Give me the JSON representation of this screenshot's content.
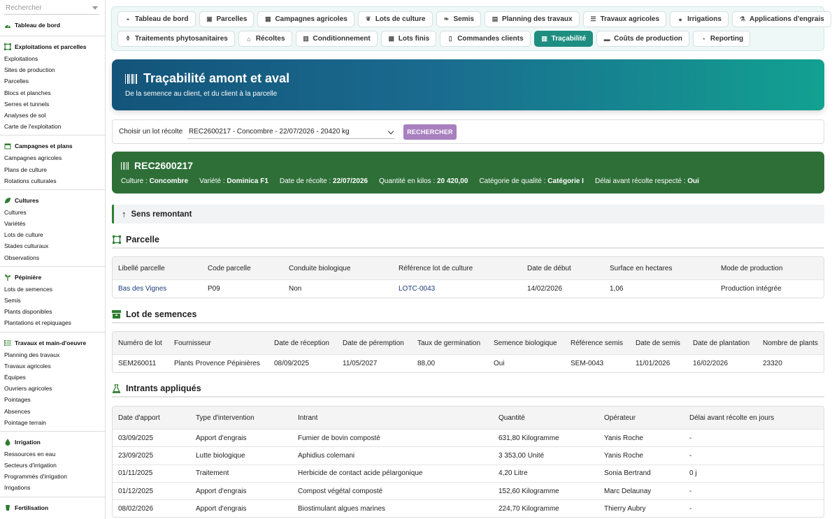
{
  "sidebar": {
    "search_placeholder": "Rechercher",
    "dashboard": "Tableau de bord",
    "sections": [
      {
        "title": "Exploitations et parcelles",
        "items": [
          "Exploitations",
          "Sites de production",
          "Parcelles",
          "Blocs et planches",
          "Serres et tunnels",
          "Analyses de sol",
          "Carte de l'exploitation"
        ]
      },
      {
        "title": "Campagnes et plans",
        "items": [
          "Campagnes agricoles",
          "Plans de culture",
          "Rotations culturales"
        ]
      },
      {
        "title": "Cultures",
        "items": [
          "Cultures",
          "Variétés",
          "Lots de culture",
          "Stades culturaux",
          "Observations"
        ]
      },
      {
        "title": "Pépinière",
        "items": [
          "Lots de semences",
          "Semis",
          "Plants disponibles",
          "Plantations et repiquages"
        ]
      },
      {
        "title": "Travaux et main-d'oeuvre",
        "items": [
          "Planning des travaux",
          "Travaux agricoles",
          "Équipes",
          "Ouvriers agricoles",
          "Pointages",
          "Absences",
          "Pointage terrain"
        ]
      },
      {
        "title": "Irrigation",
        "items": [
          "Ressources en eau",
          "Secteurs d'irrigation",
          "Programmés d'irrigation",
          "Irrigations"
        ]
      },
      {
        "title": "Fertilisation",
        "items": []
      }
    ]
  },
  "topnav": {
    "row1": [
      "Tableau de bord",
      "Parcelles",
      "Campagnes agricoles",
      "Lots de culture",
      "Semis",
      "Planning des travaux",
      "Travaux agricoles",
      "Irrigations",
      "Applications d'engrais"
    ],
    "row2": [
      "Traitements phytosanitaires",
      "Récoltes",
      "Conditionnement",
      "Lots finis",
      "Commandes clients",
      "Traçabilité",
      "Coûts de production",
      "Reporting"
    ]
  },
  "hero": {
    "title": "Traçabilité amont et aval",
    "subtitle": "De la semence au client, et du client à la parcelle"
  },
  "selector": {
    "label": "Choisir un lot récolte",
    "value": "REC2600217 - Concombre - 22/07/2026 - 20420 kg",
    "button": "RECHERCHER"
  },
  "lot": {
    "code": "REC2600217",
    "facts": [
      {
        "label": "Culture : ",
        "value": "Concombre"
      },
      {
        "label": "Variété : ",
        "value": "Dominica F1"
      },
      {
        "label": "Date de récolte : ",
        "value": "22/07/2026"
      },
      {
        "label": "Quantité en kilos : ",
        "value": "20 420,00"
      },
      {
        "label": "Catégorie de qualité : ",
        "value": "Catégorie I"
      },
      {
        "label": "Délai avant récolte respecté : ",
        "value": "Oui"
      }
    ]
  },
  "direction": "Sens remontant",
  "parcelle": {
    "title": "Parcelle",
    "headers": [
      "Libellé parcelle",
      "Code parcelle",
      "Conduite biologique",
      "Référence lot de culture",
      "Date de début",
      "Surface en hectares",
      "Mode de production"
    ],
    "rows": [
      [
        "Bas des Vignes",
        "P09",
        "Non",
        "LOTC-0043",
        "14/02/2026",
        "1,06",
        "Production intégrée"
      ]
    ]
  },
  "semences": {
    "title": "Lot de semences",
    "headers": [
      "Numéro de lot",
      "Fournisseur",
      "Date de réception",
      "Date de péremption",
      "Taux de germination",
      "Semence biologique",
      "Référence semis",
      "Date de semis",
      "Date de plantation",
      "Nombre de plants"
    ],
    "rows": [
      [
        "SEM260011",
        "Plants Provence Pépinières",
        "08/09/2025",
        "11/05/2027",
        "88,00",
        "Oui",
        "SEM-0043",
        "11/01/2026",
        "16/02/2026",
        "23320"
      ]
    ]
  },
  "intrants": {
    "title": "Intrants appliqués",
    "headers": [
      "Date d'apport",
      "Type d'intervention",
      "Intrant",
      "Quantité",
      "Opérateur",
      "Délai avant récolte en jours"
    ],
    "rows": [
      [
        "03/09/2025",
        "Apport d'engrais",
        "Fumier de bovin composté",
        "631,80 Kilogramme",
        "Yanis Roche",
        "-"
      ],
      [
        "23/09/2025",
        "Lutte biologique",
        "Aphidius colemani",
        "3 353,00 Unité",
        "Yanis Roche",
        "-"
      ],
      [
        "01/11/2025",
        "Traitement",
        "Herbicide de contact acide pélargonique",
        "4,20 Litre",
        "Sonia Bertrand",
        "0 j"
      ],
      [
        "01/12/2025",
        "Apport d'engrais",
        "Compost végétal composté",
        "152,60 Kilogramme",
        "Marc Delaunay",
        "-"
      ],
      [
        "08/02/2026",
        "Apport d'engrais",
        "Biostimulant algues marines",
        "224,70 Kilogramme",
        "Thierry Aubry",
        "-"
      ]
    ]
  }
}
